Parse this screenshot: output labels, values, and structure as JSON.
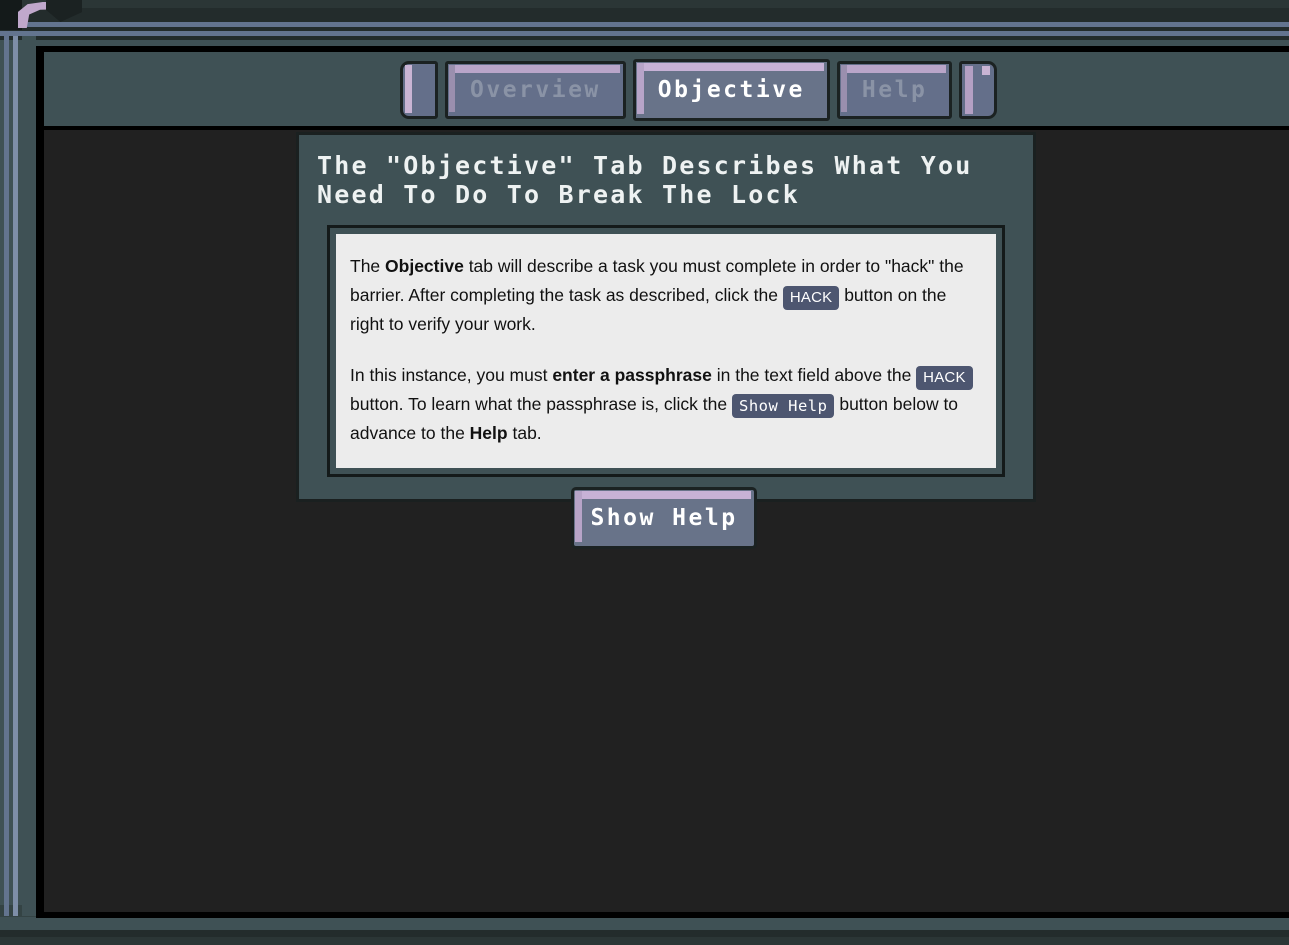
{
  "window": {
    "theme": {
      "frame_slate": "#3f5155",
      "content_dark": "#212121",
      "accent_lavender": "#c7b2d6",
      "tab_fill": "#646f8a",
      "badge_bg": "#4d5670",
      "card_bg": "#ececec",
      "rail_steel": "#63748f"
    }
  },
  "tabbar": {
    "tabs": [
      {
        "label": "Overview",
        "active": false
      },
      {
        "label": "Objective",
        "active": true
      },
      {
        "label": "Help",
        "active": false
      }
    ]
  },
  "header": {
    "title": "The \"Objective\" Tab Describes What You\nNeed To Do To Break The Lock"
  },
  "card": {
    "paragraph1": {
      "part1": "The ",
      "bold1": "Objective",
      "part2": " tab will describe a task you must complete in order to \"hack\" the barrier. After completing the task as described, click the ",
      "badge1": "HACK",
      "part3": " button on the right to verify your work."
    },
    "paragraph2": {
      "part1": "In this instance, you must ",
      "bold1": "enter a passphrase",
      "part2": " in the text field above the ",
      "badge1": "HACK",
      "part3": " button. To learn what the passphrase is, click the ",
      "badge2": "Show Help",
      "part4": " button below to advance to the ",
      "bold2": "Help",
      "part5": " tab."
    }
  },
  "actions": {
    "show_help_label": "Show Help"
  }
}
